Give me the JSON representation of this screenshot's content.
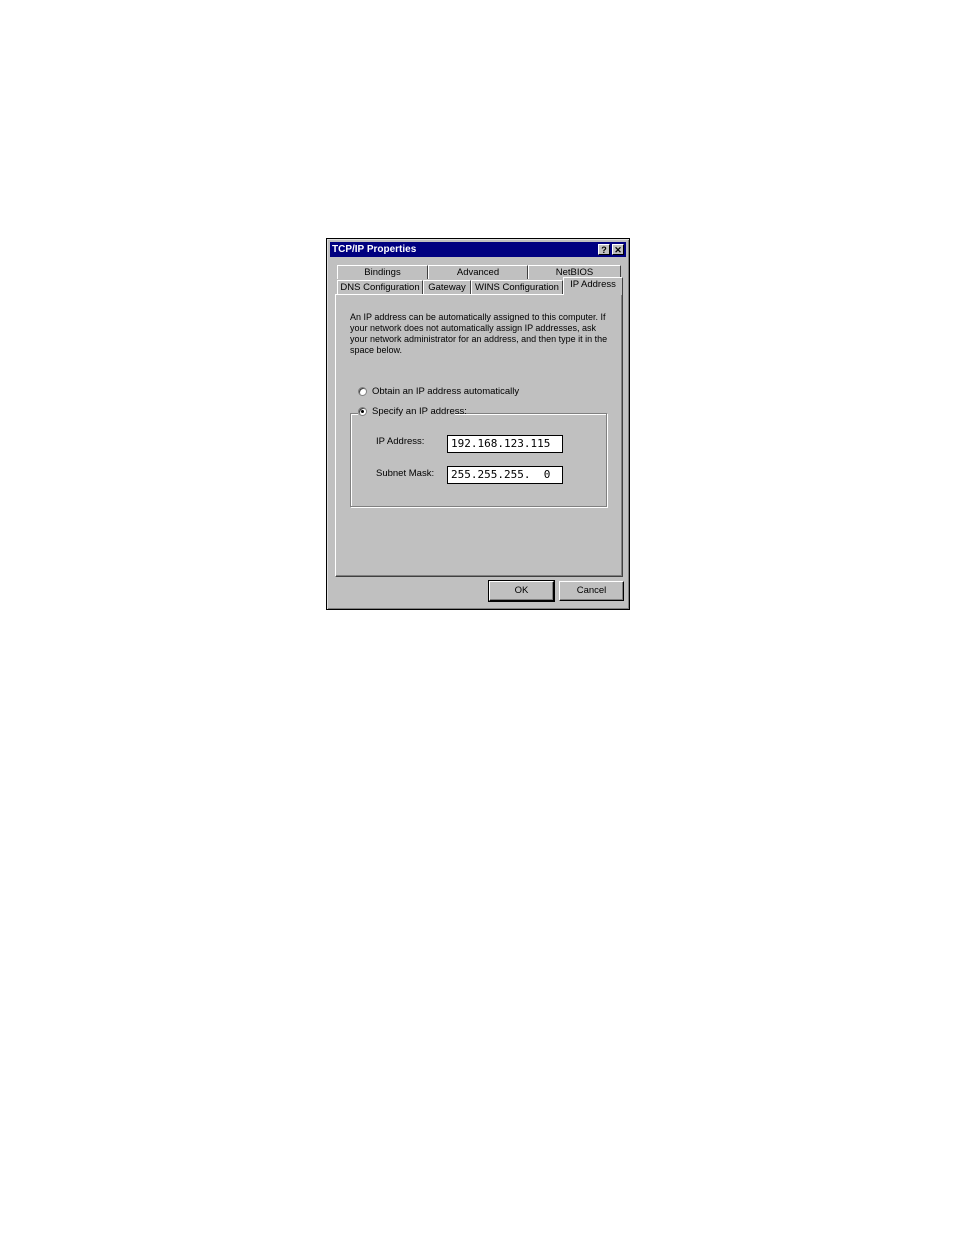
{
  "window": {
    "title": "TCP/IP Properties",
    "help_glyph": "?",
    "close_glyph": "✕"
  },
  "tabs_back_row": [
    "Bindings",
    "Advanced",
    "NetBIOS"
  ],
  "tabs_front_row": [
    "DNS Configuration",
    "Gateway",
    "WINS Configuration",
    "IP Address"
  ],
  "active_tab": "IP Address",
  "intro_text": "An IP address can be automatically assigned to this computer. If your network does not automatically assign IP addresses, ask your network administrator for an address, and then type it in the space below.",
  "options": {
    "obtain_label": "Obtain an IP address automatically",
    "specify_label": "Specify an IP address:",
    "selected": "specify"
  },
  "fields": {
    "ip_label": "IP Address:",
    "ip_value": "192.168.123.115",
    "mask_label": "Subnet Mask:",
    "mask_value": "255.255.255.  0"
  },
  "buttons": {
    "ok": "OK",
    "cancel": "Cancel"
  }
}
